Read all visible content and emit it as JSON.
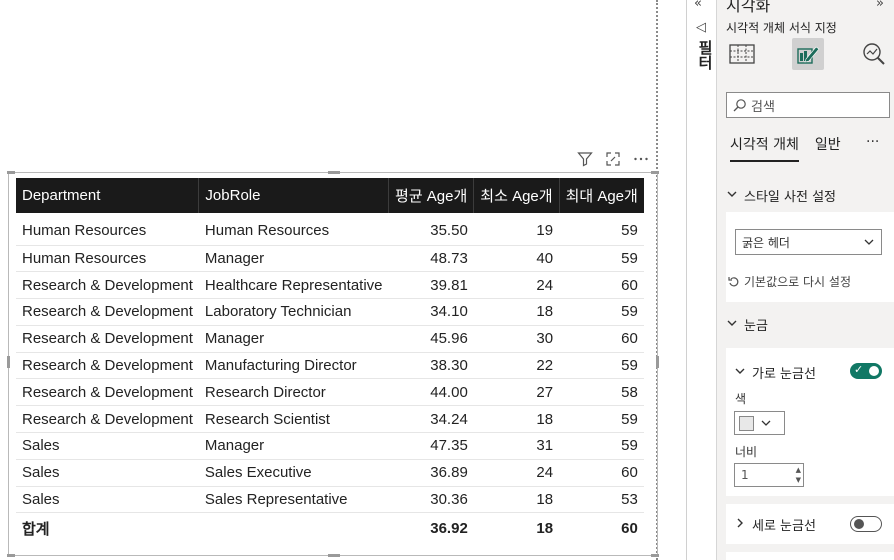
{
  "visual_header": {
    "filter_icon": "filter-icon",
    "focus_icon": "focus-mode-icon",
    "more_icon": "more-options-icon"
  },
  "table": {
    "columns": [
      "Department",
      "JobRole",
      "평균 Age개",
      "최소 Age개",
      "최대 Age개"
    ],
    "rows": [
      [
        "Human Resources",
        "Human Resources",
        "35.50",
        "19",
        "59"
      ],
      [
        "Human Resources",
        "Manager",
        "48.73",
        "40",
        "59"
      ],
      [
        "Research & Development",
        "Healthcare Representative",
        "39.81",
        "24",
        "60"
      ],
      [
        "Research & Development",
        "Laboratory Technician",
        "34.10",
        "18",
        "59"
      ],
      [
        "Research & Development",
        "Manager",
        "45.96",
        "30",
        "60"
      ],
      [
        "Research & Development",
        "Manufacturing Director",
        "38.30",
        "22",
        "59"
      ],
      [
        "Research & Development",
        "Research Director",
        "44.00",
        "27",
        "58"
      ],
      [
        "Research & Development",
        "Research Scientist",
        "34.24",
        "18",
        "59"
      ],
      [
        "Sales",
        "Manager",
        "47.35",
        "31",
        "59"
      ],
      [
        "Sales",
        "Sales Executive",
        "36.89",
        "24",
        "60"
      ],
      [
        "Sales",
        "Sales Representative",
        "30.36",
        "18",
        "53"
      ]
    ],
    "total": {
      "label": "합계",
      "avg": "36.92",
      "min": "18",
      "max": "60"
    }
  },
  "filters_pane": {
    "label": "필터"
  },
  "format_pane": {
    "title": "시각화",
    "subtitle": "시각적 개체 서식 지정",
    "search_placeholder": "검색",
    "tabs": [
      "시각적 개체",
      "일반"
    ],
    "more": "···",
    "style_preset": {
      "header": "스타일 사전 설정",
      "selected": "굵은 헤더",
      "reset": "기본값으로 다시 설정"
    },
    "grid": {
      "header": "눈금",
      "horizontal": {
        "label": "가로 눈금선",
        "on": true,
        "color_label": "색",
        "color": "#e8e8e8",
        "width_label": "너비",
        "width_value": "1"
      },
      "vertical": {
        "label": "세로 눈금선",
        "on": false
      }
    }
  },
  "colors": {
    "header_bg": "#1a1a1a",
    "total_rule": "#1aa0a6",
    "toggle_on": "#117865"
  }
}
